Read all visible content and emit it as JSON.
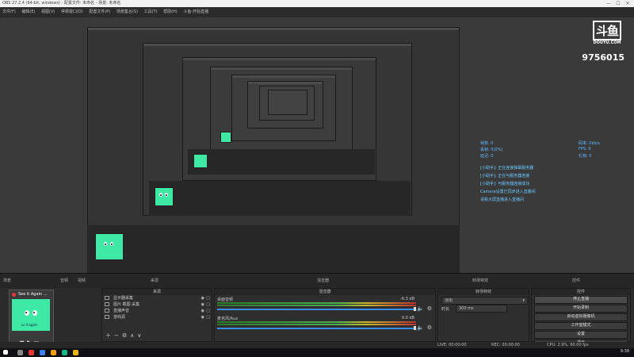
{
  "titlebar": {
    "title": "OBS 27.2.4 (64-bit, windows) - 配置文件: 未命名 - 场景: 未命名"
  },
  "menubar": {
    "items": [
      "文件(F)",
      "编辑(E)",
      "视图(V)",
      "停靠窗口(D)",
      "配置文件(P)",
      "场景集合(S)",
      "工具(T)",
      "帮助(H)",
      "斗鱼-开始直播"
    ]
  },
  "stream": {
    "brand": "斗鱼",
    "brand_sub": "DOUYU.COM",
    "room_id": "9756015"
  },
  "overlay": {
    "stats": [
      {
        "label": "帧数:",
        "value": "0"
      },
      {
        "label": "丢帧:",
        "value": "0(0%)"
      },
      {
        "label": "延迟:",
        "value": "0"
      },
      {
        "label": "码率:",
        "value": "0kb/s"
      },
      {
        "label": "FPS:",
        "value": "0"
      },
      {
        "label": "礼物:",
        "value": "0"
      }
    ],
    "chat": [
      "[小助手]: 正在连接弹幕服务器",
      "[小助手]: 正在与服务器连接",
      "[小助手]: 与服务器连接成功",
      "Camera设置已同步进入直播间",
      "请看大屏直播进入直播间"
    ]
  },
  "tabs": {
    "scenes": "场景",
    "sources": "来源",
    "mixer": "混音器",
    "transitions": "转场特效",
    "controls": "控件"
  },
  "bottom_tabs": [
    "音频",
    "视频"
  ],
  "scene_card": {
    "title": "See it Again ...",
    "thumb_label": "ur it again"
  },
  "sources": {
    "header": "来源",
    "items": [
      "显示器采集",
      "图片 截图 采集",
      "直播声音",
      "游戏源"
    ]
  },
  "mixer": {
    "header": "混音器",
    "channels": [
      {
        "name": "桌面音频",
        "db": "-6.3 dB"
      },
      {
        "name": "麦克风/Aux",
        "db": "0.0 dB"
      }
    ]
  },
  "transitions": {
    "header": "转场特效",
    "mode": "淡出",
    "duration_label": "时长",
    "duration": "300 ms"
  },
  "controls": {
    "header": "控件",
    "buttons": [
      "停止直播",
      "开始录制",
      "启动虚拟摄像机",
      "工作室模式",
      "设置",
      "退出"
    ]
  },
  "status": {
    "live": "LIVE: 00:00:00",
    "rec": "REC: 00:00:00",
    "cpu": "CPU: 2.9%, 60.00 fps"
  },
  "clock": "9:38",
  "colors": {
    "accent": "#3ee8a5",
    "stat": "#5fb5ff",
    "chat": "#6cc8ff"
  }
}
